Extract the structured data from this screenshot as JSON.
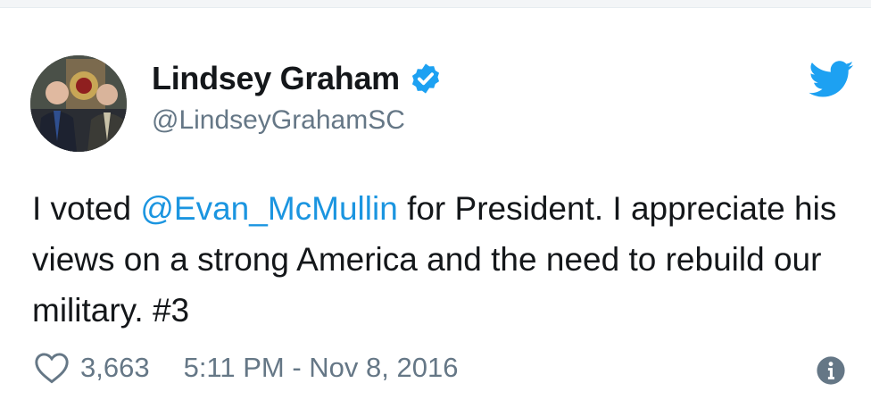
{
  "tweet": {
    "author_name": "Lindsey Graham",
    "handle": "@LindseyGrahamSC",
    "verified": true,
    "text_parts": {
      "pre": "I voted ",
      "mention": "@Evan_McMullin",
      "post": " for President. I appreciate his views on a strong America and the need to rebuild our military. #3"
    },
    "like_count": "3,663",
    "timestamp": "5:11 PM - Nov 8, 2016"
  },
  "icons": {
    "avatar": "avatar-photo",
    "verified": "verified-badge-icon",
    "brand": "twitter-bird-icon",
    "like": "heart-icon",
    "info": "info-icon"
  },
  "colors": {
    "accent": "#1da1f2",
    "mention": "#1b95e0",
    "secondary_text": "#657786",
    "primary_text": "#14171a"
  }
}
